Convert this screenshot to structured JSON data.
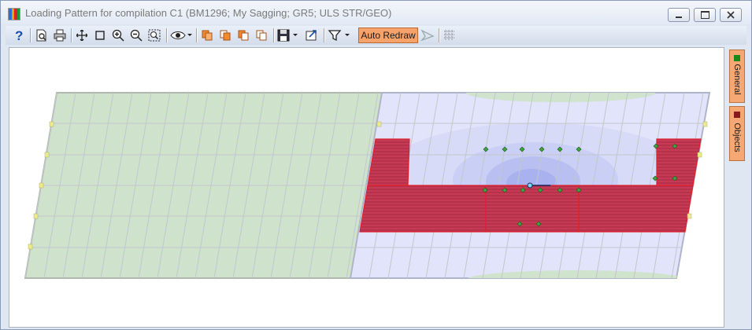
{
  "window": {
    "title": "Loading Pattern for compilation C1 (BM1296; My Sagging; GR5; ULS STR/GEO)",
    "icon": "bar-chart-app-icon",
    "buttons": [
      "minimize-icon",
      "maximize-icon",
      "close-icon"
    ]
  },
  "toolbar": {
    "buttons": [
      "help-icon",
      "print-preview-icon",
      "print-icon",
      "pan-icon",
      "zoom-window-icon",
      "zoom-in-icon",
      "zoom-out-icon",
      "zoom-extents-icon",
      "view-eye-icon",
      "copy-orange-1-icon",
      "copy-orange-2-icon",
      "copy-orange-3-icon",
      "copy-orange-4-icon",
      "save-icon",
      "export-icon",
      "filter-icon",
      "arrow-tool-icon",
      "grid-icon"
    ],
    "auto_redraw_label": "Auto Redraw"
  },
  "side_tabs": [
    {
      "label": "General",
      "color": "#1b8a1b"
    },
    {
      "label": "Objects",
      "color": "#8a1b1b"
    }
  ],
  "colors": {
    "green_panel": "#cfe2cc",
    "blue_panel": "#e2e4fb",
    "load_fill": "#b8314a",
    "load_edge": "#e0202c",
    "accent": "#f5a36b"
  }
}
